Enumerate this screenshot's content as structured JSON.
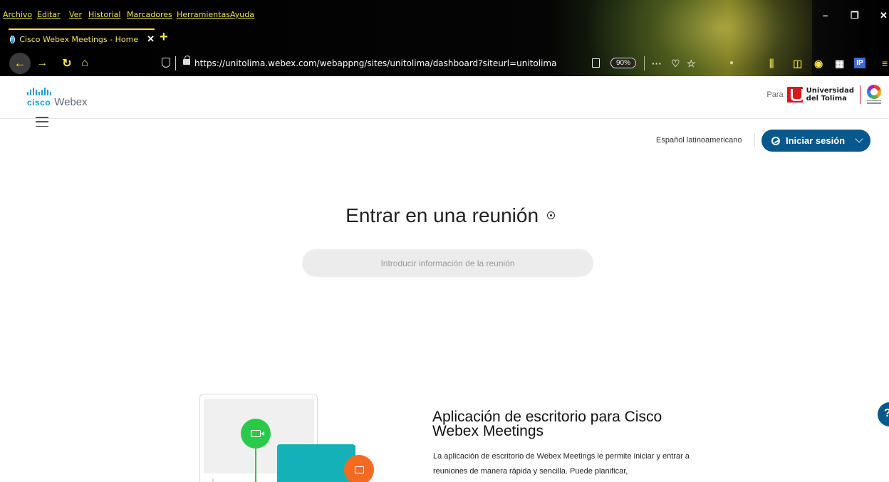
{
  "browser": {
    "menu": [
      "Archivo",
      "Editar",
      "Ver",
      "Historial",
      "Marcadores",
      "Herramientas",
      "Ayuda"
    ],
    "window_controls": {
      "minimize": "–",
      "restore": "❐",
      "close": "✕"
    },
    "tab": {
      "title": "Cisco Webex Meetings - Home",
      "close": "✕"
    },
    "new_tab": "+",
    "url": "https://unitolima.webex.com/webappng/sites/unitolima/dashboard?siteurl=unitolima",
    "zoom": "90%",
    "more_actions": "···",
    "ip_badge": "IP"
  },
  "header": {
    "brand_cisco": "cisco",
    "brand_product": "Webex",
    "partner_prefix": "Para",
    "partner_name_line1": "Universidad",
    "partner_name_line2": "del Tolima"
  },
  "toolbar": {
    "language": "Español latinoamericano",
    "signin_label": "Iniciar sesión"
  },
  "join": {
    "title": "Entrar en una reunión",
    "input_placeholder": "Introducir información de la reunión"
  },
  "promo": {
    "title": "Aplicación de escritorio para Cisco Webex Meetings",
    "description": "La aplicación de escritorio de Webex Meetings le permite iniciar y entrar a reuniones de manera rápida y sencilla. Puede planificar,"
  },
  "help_fab": "?",
  "colors": {
    "accent": "#07588d",
    "cisco_blue": "#049fd9",
    "chrome_text": "#f2e34a",
    "video_green": "#2bc94a",
    "share_orange": "#f26b21",
    "teal": "#14b2b8"
  }
}
